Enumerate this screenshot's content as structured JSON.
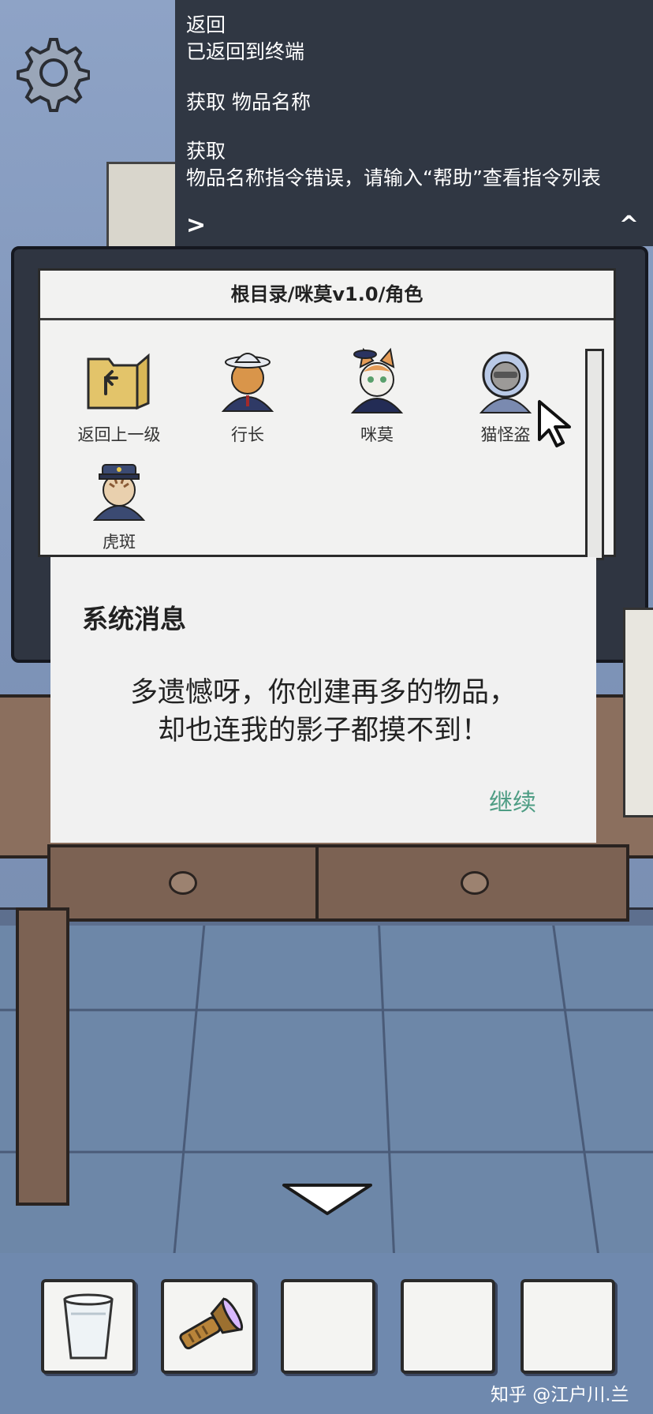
{
  "console": {
    "lines": [
      "返回",
      "已返回到终端",
      "获取 物品名称",
      "获取",
      "物品名称指令错误，请输入“帮助”查看指令列表"
    ],
    "prompt_symbol": ">",
    "toggle_symbol": "^"
  },
  "file_window": {
    "title": "根目录/咪莫v1.0/角色",
    "items": [
      {
        "label": "返回上一级",
        "icon": "folder-up-icon"
      },
      {
        "label": "行长",
        "icon": "cat-banker-icon"
      },
      {
        "label": "咪莫",
        "icon": "cat-mimo-icon"
      },
      {
        "label": "猫怪盗",
        "icon": "cat-phantom-thief-icon"
      },
      {
        "label": "虎斑",
        "icon": "cat-tabby-officer-icon"
      }
    ]
  },
  "dialog": {
    "title": "系统消息",
    "message_line1": "多遗憾呀，你创建再多的物品，",
    "message_line2": "却也连我的影子都摸不到！",
    "continue_label": "继续"
  },
  "inventory": {
    "slots": [
      {
        "item": "paper-cup-icon"
      },
      {
        "item": "flashlight-icon"
      },
      {
        "item": ""
      },
      {
        "item": ""
      },
      {
        "item": ""
      }
    ]
  },
  "watermark": "知乎 @江户川.兰",
  "colors": {
    "console_bg": "#303743",
    "dialog_bg": "#f1f1f1",
    "continue_text": "#4e9d84",
    "wall": "#8ea3c6"
  }
}
